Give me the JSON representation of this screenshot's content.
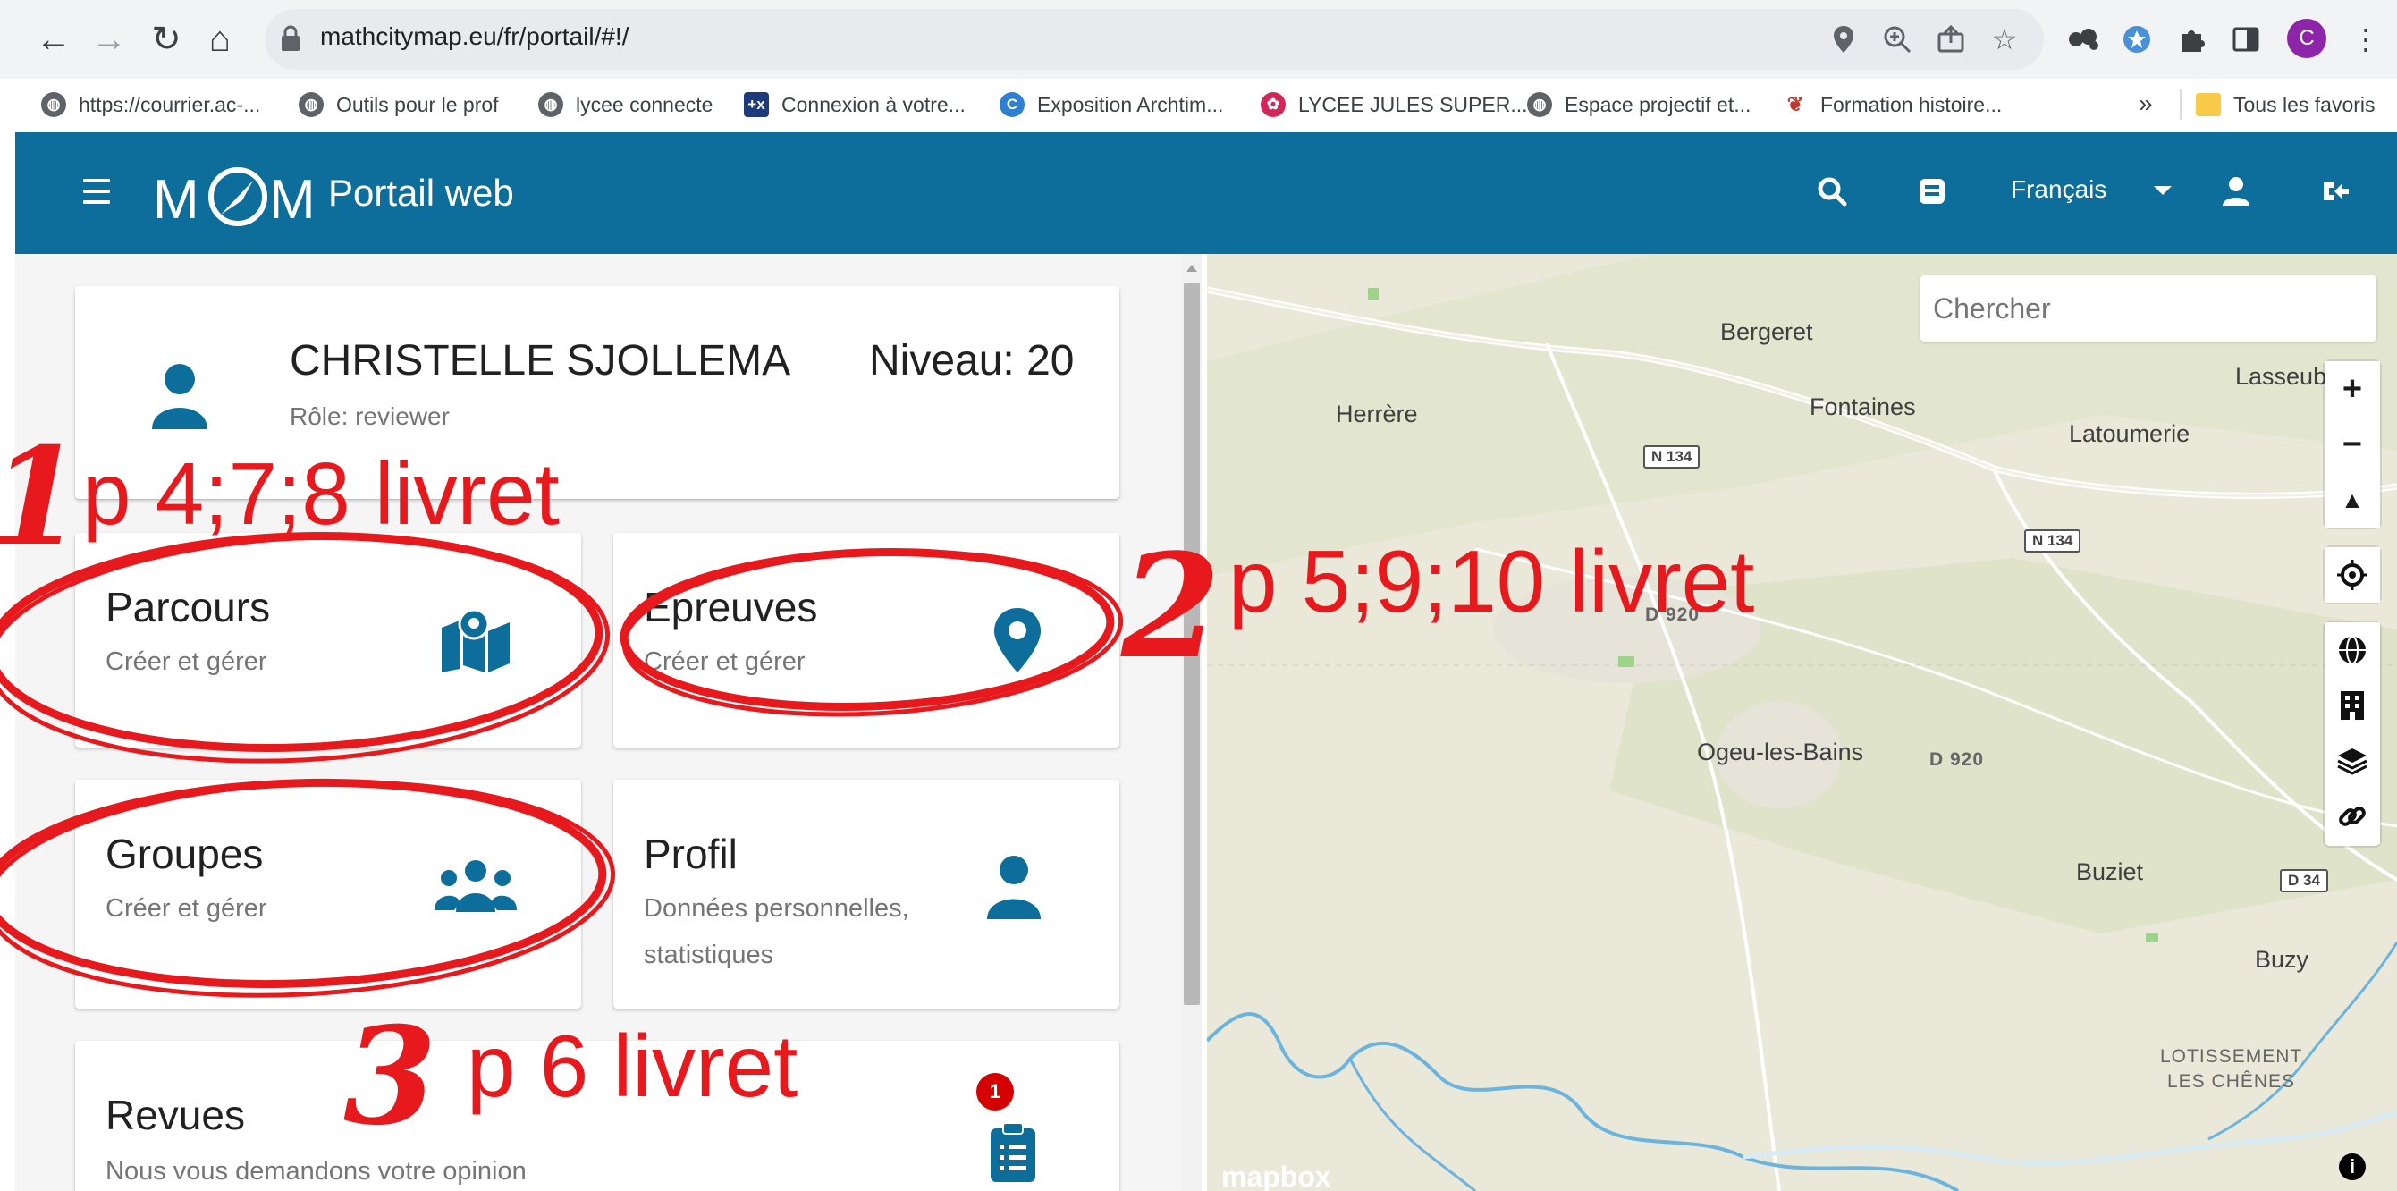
{
  "browser": {
    "url": "mathcitymap.eu/fr/portail/#!/",
    "avatar_letter": "C"
  },
  "bookmarks": [
    {
      "label": "https://courrier.ac-...",
      "icon": "globe-icon"
    },
    {
      "label": "Outils pour le prof",
      "icon": "globe-icon"
    },
    {
      "label": "lycee connecte",
      "icon": "globe-icon"
    },
    {
      "label": "Connexion à votre...",
      "icon": "plus-x-icon"
    },
    {
      "label": "Exposition Archtim...",
      "icon": "c-logo-icon"
    },
    {
      "label": "LYCEE JULES SUPER...",
      "icon": "school-logo-icon"
    },
    {
      "label": "Espace projectif et...",
      "icon": "globe-icon"
    },
    {
      "label": "Formation histoire...",
      "icon": "flower-icon"
    }
  ],
  "bookmarks_overflow": "»",
  "all_bookmarks": "Tous les favoris",
  "app": {
    "title": "Portail web",
    "language": "Français",
    "accent": "#0d6e9c"
  },
  "user": {
    "name": "CHRISTELLE SJOLLEMA",
    "level": "Niveau: 20",
    "role": "Rôle: reviewer"
  },
  "cards": {
    "parcours": {
      "title": "Parcours",
      "sub": "Créer et gérer"
    },
    "epreuves": {
      "title": "Epreuves",
      "sub": "Créer et gérer"
    },
    "groupes": {
      "title": "Groupes",
      "sub": "Créer et gérer"
    },
    "profil": {
      "title": "Profil",
      "sub1": "Données personnelles,",
      "sub2": "statistiques"
    },
    "revues": {
      "title": "Revues",
      "sub": "Nous vous demandons votre opinion",
      "badge": "1"
    }
  },
  "map": {
    "search_placeholder": "Chercher",
    "attribution": "mapbox",
    "places": {
      "bergeret": "Bergeret",
      "herrere": "Herrère",
      "fontaines": "Fontaines",
      "lasseube": "Lasseub",
      "latoumerie": "Latoumerie",
      "ogeu": "Ogeu-les-Bains",
      "buziet": "Buziet",
      "buzy": "Buzy",
      "lotissement": "LOTISSEMENT",
      "les_chenes": "LES CHÊNES"
    },
    "roads": {
      "n134a": "N 134",
      "n134b": "N 134",
      "d920a": "D 920",
      "d920b": "D 920",
      "d34": "D 34"
    }
  },
  "annotations": {
    "one_num": "1",
    "one_text": "p 4;7;8 livret",
    "two_num": "2",
    "two_text": "p 5;9;10 livret",
    "three_num": "3",
    "three_text": "p 6 livret",
    "color": "#e8191d"
  }
}
